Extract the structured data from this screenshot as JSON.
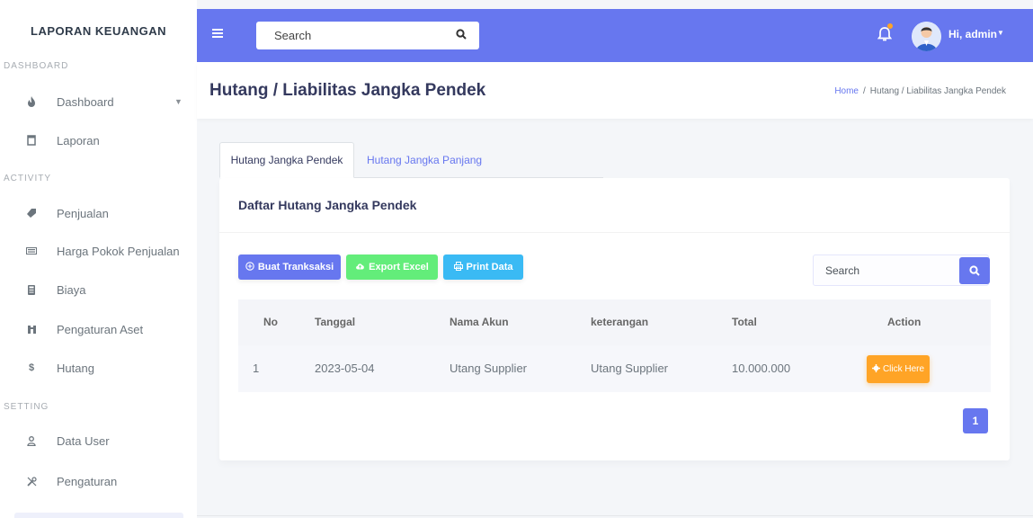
{
  "sidebar": {
    "brand": "LAPORAN KEUANGAN",
    "sections": [
      {
        "label": "DASHBOARD"
      },
      {
        "label": "ACTIVITY"
      },
      {
        "label": "SETTING"
      }
    ],
    "items": [
      {
        "label": "Dashboard",
        "icon": "fire-icon"
      },
      {
        "label": "Laporan",
        "icon": "file-icon"
      },
      {
        "label": "Penjualan",
        "icon": "tag-icon"
      },
      {
        "label": "Harga Pokok Penjualan",
        "icon": "money-icon"
      },
      {
        "label": "Biaya",
        "icon": "calculator-icon"
      },
      {
        "label": "Pengaturan Aset",
        "icon": "building-icon"
      },
      {
        "label": "Hutang",
        "icon": "dollar-icon"
      },
      {
        "label": "Data User",
        "icon": "user-icon"
      },
      {
        "label": "Pengaturan",
        "icon": "tools-icon"
      }
    ]
  },
  "topbar": {
    "search_placeholder": "Search",
    "user_greeting": "Hi, admin"
  },
  "header": {
    "title": "Hutang / Liabilitas Jangka Pendek",
    "breadcrumb_home": "Home",
    "breadcrumb_sep": "/",
    "breadcrumb_current": "Hutang / Liabilitas Jangka Pendek"
  },
  "tabs": [
    {
      "label": "Hutang Jangka Pendek",
      "active": true
    },
    {
      "label": "Hutang Jangka Panjang",
      "active": false
    }
  ],
  "card": {
    "title": "Daftar Hutang Jangka Pendek",
    "buttons": {
      "create": "Buat Tranksaksi",
      "export": "Export Excel",
      "print": "Print Data"
    },
    "search_placeholder": "Search",
    "table": {
      "headers": [
        "No",
        "Tanggal",
        "Nama Akun",
        "keterangan",
        "Total",
        "Action"
      ],
      "rows": [
        {
          "no": "1",
          "tanggal": "2023-05-04",
          "nama_akun": "Utang Supplier",
          "keterangan": "Utang Supplier",
          "total": "10.000.000",
          "action": "Click Here"
        }
      ]
    },
    "pagination": {
      "current": "1"
    }
  },
  "colors": {
    "primary": "#6777ef",
    "success": "#63ed7a",
    "info": "#3abaf4",
    "warning": "#ffa426"
  }
}
